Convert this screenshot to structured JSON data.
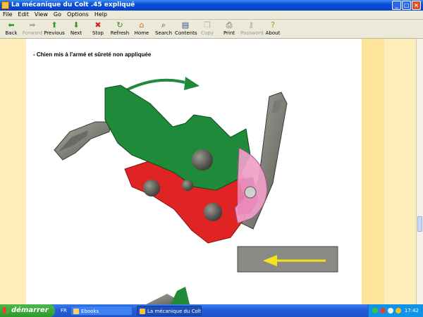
{
  "window": {
    "title": "La mécanique du Colt .45 expliqué"
  },
  "menu": [
    "File",
    "Edit",
    "View",
    "Go",
    "Options",
    "Help"
  ],
  "toolbar": [
    {
      "label": "Back",
      "icon": "back-arrow-icon",
      "enabled": true
    },
    {
      "label": "Forward",
      "icon": "forward-arrow-icon",
      "enabled": false
    },
    {
      "label": "Previous",
      "icon": "up-arrow-icon",
      "enabled": true
    },
    {
      "label": "Next",
      "icon": "down-arrow-icon",
      "enabled": true
    },
    {
      "label": "Stop",
      "icon": "stop-icon",
      "enabled": true
    },
    {
      "label": "Refresh",
      "icon": "refresh-icon",
      "enabled": true
    },
    {
      "label": "Home",
      "icon": "home-icon",
      "enabled": true
    },
    {
      "label": "Search",
      "icon": "search-icon",
      "enabled": true
    },
    {
      "label": "Contents",
      "icon": "contents-icon",
      "enabled": true
    },
    {
      "label": "Copy",
      "icon": "copy-icon",
      "enabled": false
    },
    {
      "label": "Print",
      "icon": "print-icon",
      "enabled": true
    },
    {
      "label": "Password",
      "icon": "key-icon",
      "enabled": false
    },
    {
      "label": "About",
      "icon": "about-icon",
      "enabled": true
    }
  ],
  "page": {
    "caption": "- Chien mis à l'armé et sûreté non appliquée"
  },
  "colors": {
    "hammer": "#1e8a3a",
    "sear": "#e02424",
    "safety": "#f0a0c8",
    "arrow_green": "#1e8a3a",
    "arrow_yellow": "#f4e21a"
  },
  "taskbar": {
    "start_label": "démarrer",
    "lang": "FR",
    "tasks": [
      {
        "label": "Ebooks",
        "icon": "folder-icon",
        "active": false
      },
      {
        "label": "La mécanique du Colt...",
        "icon": "help-window-icon",
        "active": true
      }
    ],
    "clock": "17:42"
  }
}
